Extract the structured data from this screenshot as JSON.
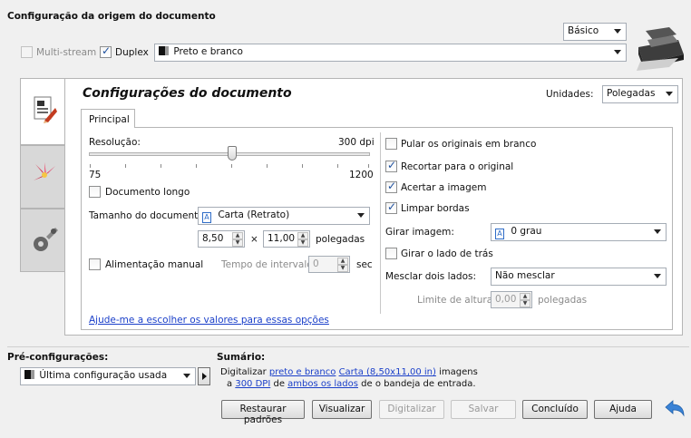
{
  "source": {
    "title": "Configuração da origem do documento",
    "mode_select": "Básico",
    "multistream_label": "Multi-stream",
    "duplex_label": "Duplex",
    "color_mode": "Preto e branco"
  },
  "document": {
    "title": "Configurações do documento",
    "units_label": "Unidades:",
    "units_value": "Polegadas",
    "tab_principal": "Principal",
    "resolution_label": "Resolução:",
    "resolution_value": "300 dpi",
    "resolution_dpi": 300,
    "slider_min": "75",
    "slider_max": "1200",
    "long_doc_label": "Documento longo",
    "doc_size_label": "Tamanho do documento:",
    "doc_size_value": "Carta (Retrato)",
    "width": "8,50",
    "times": "×",
    "height": "11,00",
    "inches": "polegadas",
    "manual_feed_label": "Alimentação manual",
    "interval_label": "Tempo de intervalo:",
    "interval_value": "0",
    "interval_unit": "sec",
    "help_link": "Ajude-me a escolher os valores para essas opções",
    "skip_blank_label": "Pular os originais em branco",
    "crop_label": "Recortar para o original",
    "straighten_label": "Acertar a imagem",
    "clean_edges_label": "Limpar bordas",
    "rotate_label": "Girar imagem:",
    "rotate_value": "0 grau",
    "rotate_back_label": "Girar o lado de trás",
    "merge_label": "Mesclar dois lados:",
    "merge_value": "Não mesclar",
    "height_limit_label": "Limite de altura:",
    "height_limit_value": "0,00",
    "height_limit_unit": "polegadas"
  },
  "presets": {
    "label": "Pré-configurações:",
    "value": "Última configuração usada"
  },
  "summary": {
    "label": "Sumário:",
    "t1": "Digitalizar",
    "l1": "preto e branco",
    "l2": "Carta (8,50x11,00 in)",
    "t2": "imagens",
    "t3": "a",
    "l3": "300 DPI",
    "t4": "de",
    "l4": "ambos os lados",
    "t5": "de o bandeja de entrada."
  },
  "buttons": {
    "restore": "Restaurar padrões",
    "preview": "Visualizar",
    "scan": "Digitalizar",
    "save": "Salvar",
    "done": "Concluído",
    "help": "Ajuda"
  }
}
